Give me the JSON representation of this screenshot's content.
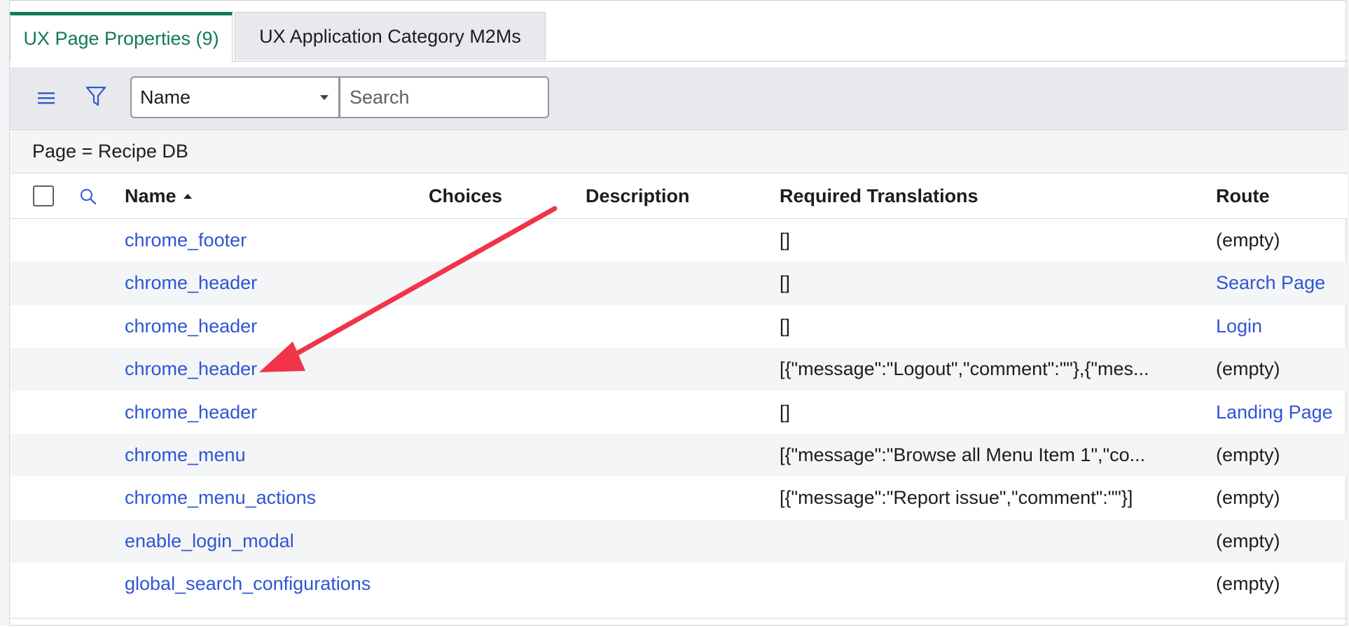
{
  "tabs": [
    {
      "label": "UX Page Properties (9)"
    },
    {
      "label": "UX Application Category M2Ms"
    }
  ],
  "toolbar": {
    "field_select": "Name",
    "search_placeholder": "Search"
  },
  "filter": {
    "text": "Page = Recipe DB"
  },
  "columns": {
    "name": "Name",
    "choices": "Choices",
    "description": "Description",
    "translations": "Required Translations",
    "route": "Route"
  },
  "rows": [
    {
      "name": "chrome_footer",
      "translations": "[]",
      "route": "(empty)",
      "route_link": false
    },
    {
      "name": "chrome_header",
      "translations": "[]",
      "route": "Search Page",
      "route_link": true
    },
    {
      "name": "chrome_header",
      "translations": "[]",
      "route": "Login",
      "route_link": true
    },
    {
      "name": "chrome_header",
      "translations": "[{\"message\":\"Logout\",\"comment\":\"\"},{\"mes...",
      "route": "(empty)",
      "route_link": false
    },
    {
      "name": "chrome_header",
      "translations": "[]",
      "route": "Landing Page",
      "route_link": true
    },
    {
      "name": "chrome_menu",
      "translations": "[{\"message\":\"Browse all Menu Item 1\",\"co...",
      "route": "(empty)",
      "route_link": false
    },
    {
      "name": "chrome_menu_actions",
      "translations": "[{\"message\":\"Report issue\",\"comment\":\"\"}]",
      "route": "(empty)",
      "route_link": false
    },
    {
      "name": "enable_login_modal",
      "translations": "",
      "route": "(empty)",
      "route_link": false
    },
    {
      "name": "global_search_configurations",
      "translations": "",
      "route": "(empty)",
      "route_link": false
    }
  ],
  "colors": {
    "accent_green": "#107a56",
    "link_blue": "#2f55d4",
    "annotation_red": "#f0344a"
  }
}
